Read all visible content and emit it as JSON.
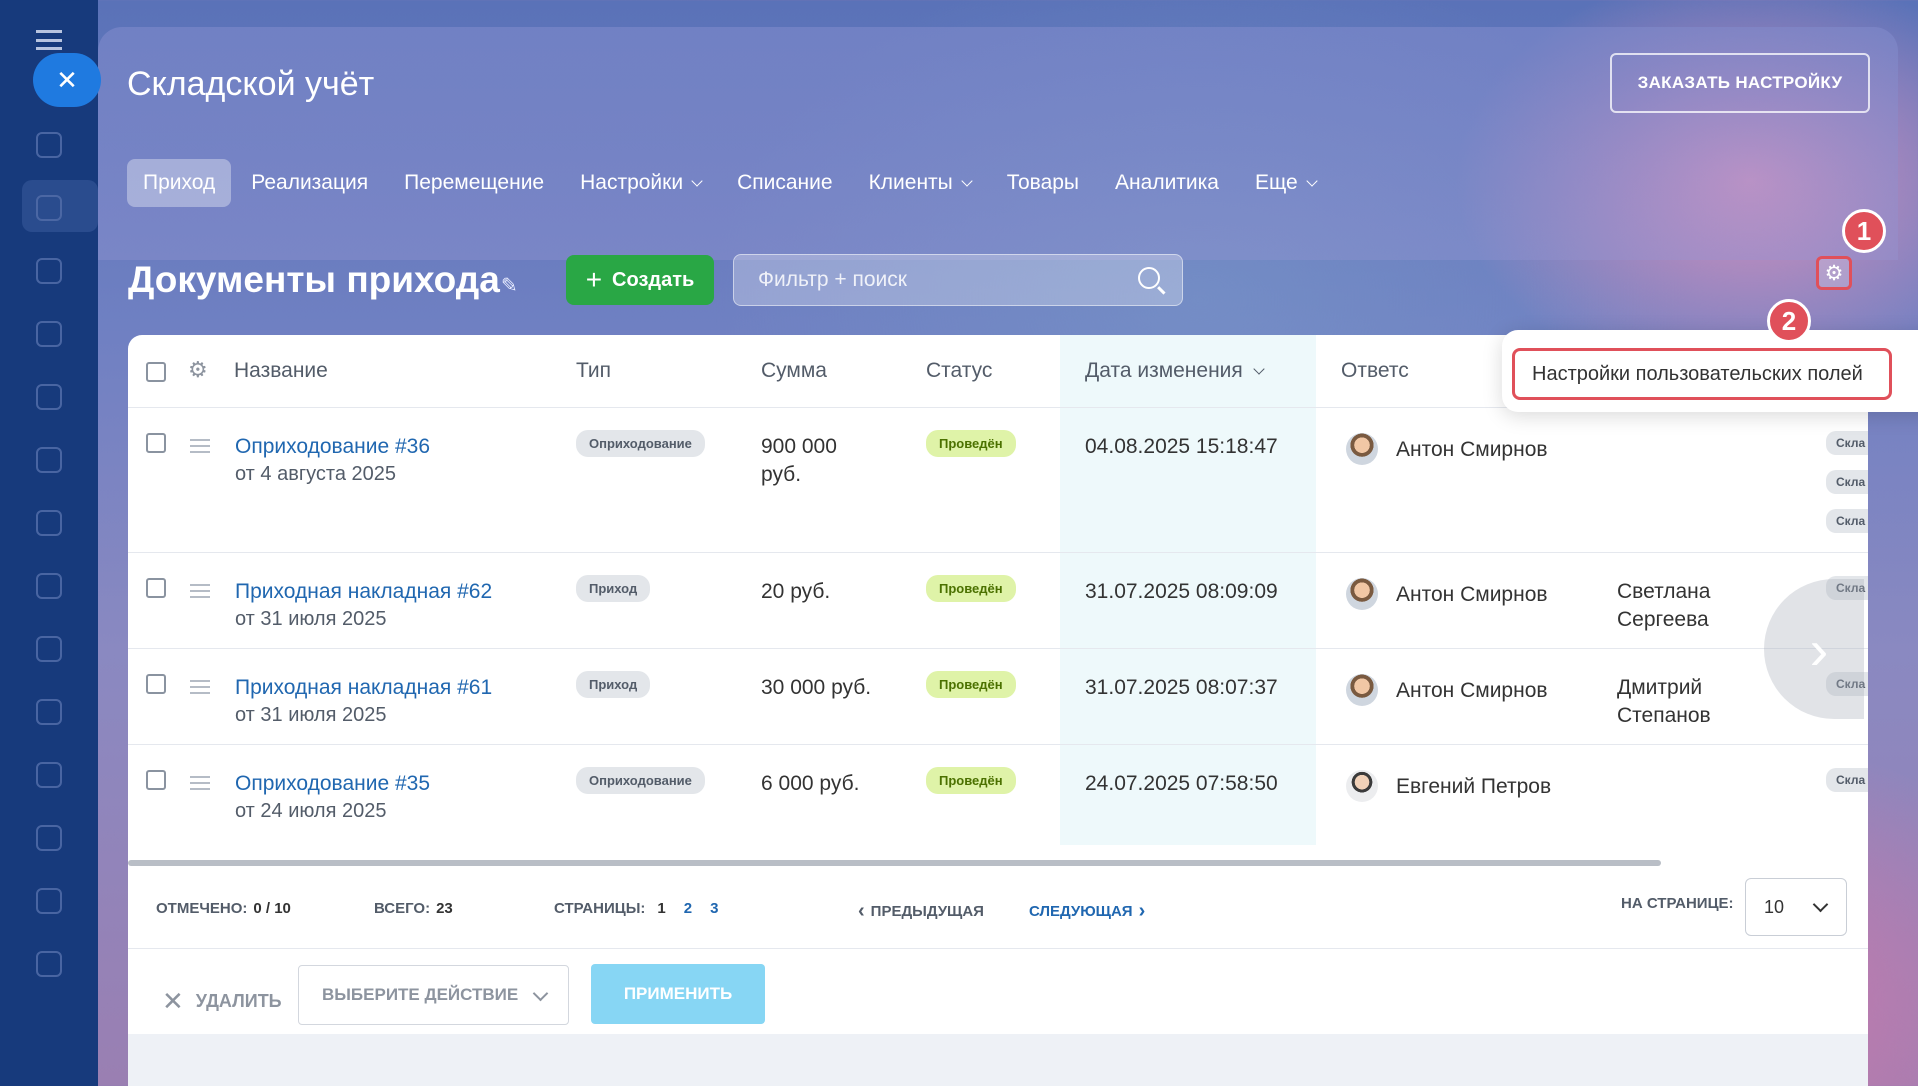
{
  "window": {
    "title": "Складской учёт",
    "order_button": "ЗАКАЗАТЬ НАСТРОЙКУ"
  },
  "tabs": [
    {
      "label": "Приход",
      "dropdown": false
    },
    {
      "label": "Реализация",
      "dropdown": false
    },
    {
      "label": "Перемещение",
      "dropdown": false
    },
    {
      "label": "Настройки",
      "dropdown": true
    },
    {
      "label": "Списание",
      "dropdown": false
    },
    {
      "label": "Клиенты",
      "dropdown": true
    },
    {
      "label": "Товары",
      "dropdown": false
    },
    {
      "label": "Аналитика",
      "dropdown": false
    },
    {
      "label": "Еще",
      "dropdown": true
    }
  ],
  "toolbar": {
    "page_title": "Документы прихода",
    "create_label": "Создать",
    "search_placeholder": "Фильтр + поиск"
  },
  "badges": {
    "one": "1",
    "two": "2"
  },
  "popup": {
    "item": "Настройки пользовательских полей"
  },
  "table": {
    "headers": {
      "name": "Название",
      "type": "Тип",
      "sum": "Сумма",
      "status": "Статус",
      "date": "Дата изменения",
      "resp": "Ответс"
    },
    "rows": [
      {
        "name": "Оприходование #36",
        "date_sub": "от 4 августа 2025",
        "type": "Оприходование",
        "sum": "900 000",
        "sum2": "руб.",
        "status": "Проведён",
        "changed": "04.08.2025 15:18:47",
        "responsible": "Антон Смирнов",
        "extra1": "",
        "extra2": "",
        "tags": [
          "Скла",
          "Скла",
          "Скла"
        ]
      },
      {
        "name": "Приходная накладная #62",
        "date_sub": "от 31 июля 2025",
        "type": "Приход",
        "sum": "20 руб.",
        "sum2": "",
        "status": "Проведён",
        "changed": "31.07.2025 08:09:09",
        "responsible": "Антон Смирнов",
        "extra1": "Светлана",
        "extra2": "Сергеева",
        "tags": [
          "Скла"
        ]
      },
      {
        "name": "Приходная накладная #61",
        "date_sub": "от 31 июля 2025",
        "type": "Приход",
        "sum": "30 000 руб.",
        "sum2": "",
        "status": "Проведён",
        "changed": "31.07.2025 08:07:37",
        "responsible": "Антон Смирнов",
        "extra1": "Дмитрий",
        "extra2": "Степанов",
        "tags": [
          "Скла"
        ]
      },
      {
        "name": "Оприходование #35",
        "date_sub": "от 24 июля 2025",
        "type": "Оприходование",
        "sum": "6 000 руб.",
        "sum2": "",
        "status": "Проведён",
        "changed": "24.07.2025 07:58:50",
        "responsible": "Евгений Петров",
        "extra1": "",
        "extra2": "",
        "tags": [
          "Скла"
        ]
      }
    ]
  },
  "footer": {
    "selected_label": "ОТМЕЧЕНО:",
    "selected_value": "0 / 10",
    "total_label": "ВСЕГО:",
    "total_value": "23",
    "pages_label": "СТРАНИЦЫ:",
    "page1": "1",
    "page2": "2",
    "page3": "3",
    "prev": "ПРЕДЫДУЩАЯ",
    "next": "СЛЕДУЮЩАЯ",
    "per_page_label": "НА СТРАНИЦЕ:",
    "per_page_value": "10",
    "delete": "УДАЛИТЬ",
    "action_placeholder": "ВЫБЕРИТЕ ДЕЙСТВИЕ",
    "apply": "ПРИМЕНИТЬ"
  }
}
